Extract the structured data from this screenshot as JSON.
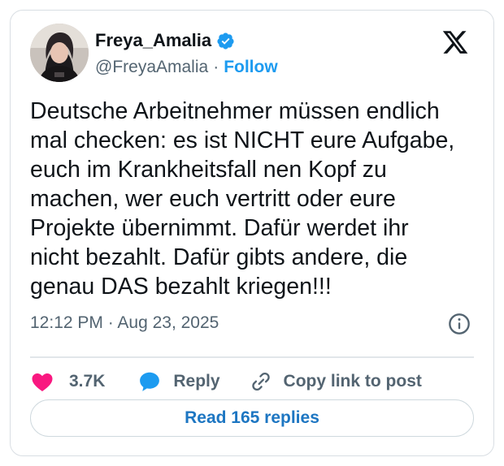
{
  "author": {
    "name": "Freya_Amalia",
    "handle": "@FreyaAmalia",
    "separator": "·",
    "follow_label": "Follow",
    "verified_icon": "verified-badge-icon",
    "verified_color": "#1d9bf0"
  },
  "brand_icon": "x-logo-icon",
  "tweet": {
    "lines": [
      "Deutsche Arbeitnehmer müssen endlich",
      "mal checken: es ist NICHT eure Aufgabe,",
      "euch im Krankheitsfall nen Kopf zu",
      "machen, wer euch vertritt oder eure",
      "Projekte übernimmt. Dafür werdet ihr",
      "nicht bezahlt. Dafür gibts andere, die",
      "genau DAS bezahlt kriegen!!!"
    ],
    "timestamp": "12:12 PM · Aug 23, 2025"
  },
  "actions": {
    "likes": "3.7K",
    "reply_label": "Reply",
    "copy_link_label": "Copy link to post",
    "like_color": "#f91880",
    "reply_color": "#1d9bf0"
  },
  "read_replies_label": "Read 165 replies"
}
